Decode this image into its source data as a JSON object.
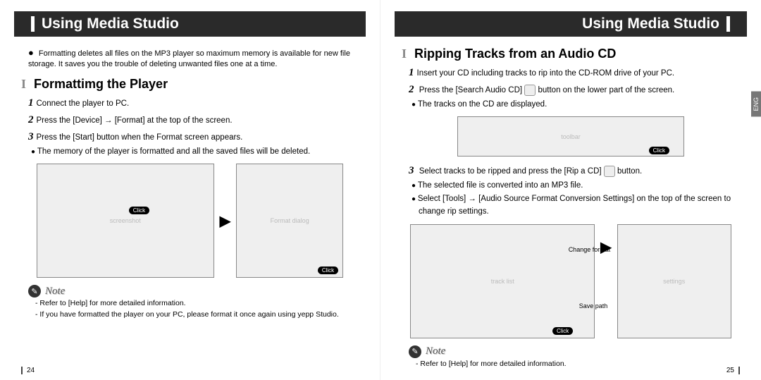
{
  "leftPage": {
    "headerTitle": "Using Media Studio",
    "intro": "Formatting deletes all files on the MP3 player so maximum memory is available for new file storage. It saves you the trouble of deleting unwanted files one at a time.",
    "sectionTitle": "Formattimg the Player",
    "steps": {
      "s1": "Connect the player to PC.",
      "s2": "Press the [Device] → [Format] at the top of the screen.",
      "s3": "Press the [Start] button when the Format screen appears.",
      "s3sub": "The memory of the player is formatted and all the saved files will be deleted."
    },
    "clickLabel": "Click",
    "noteLabel": "Note",
    "notes": [
      "Refer to [Help] for more detailed information.",
      "If you have formatted the player on your PC, please format it once again using yepp Studio."
    ],
    "pageNumber": "24"
  },
  "rightPage": {
    "headerTitle": "Using Media Studio",
    "langTab": "ENG",
    "sectionTitle": "Ripping Tracks from an Audio CD",
    "steps": {
      "s1": "Insert your CD including tracks to rip into the CD-ROM drive of your PC.",
      "s2a": "Press the [Search Audio CD]",
      "s2b": "button on the lower part of the screen.",
      "s2sub": "The tracks on the CD are displayed.",
      "s3a": "Select tracks to be ripped and press the [Rip a CD]",
      "s3b": "button.",
      "s3sub1": "The selected file is converted into an MP3 file.",
      "s3sub2": "Select [Tools] → [Audio Source Format Conversion Settings] on the top of the screen to change rip settings."
    },
    "captions": {
      "changeFormat": "Change format",
      "savePath": "Save path"
    },
    "clickLabel": "Click",
    "noteLabel": "Note",
    "notes": [
      "Refer to [Help] for more detailed information."
    ],
    "pageNumber": "25"
  }
}
